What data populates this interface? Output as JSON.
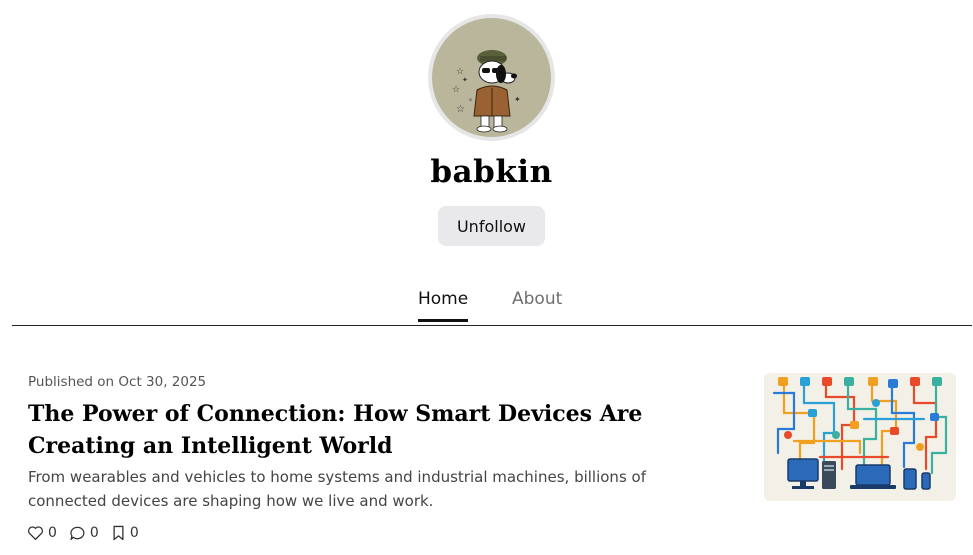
{
  "profile": {
    "username": "babkin",
    "follow_button_label": "Unfollow"
  },
  "tabs": [
    {
      "label": "Home",
      "active": true
    },
    {
      "label": "About",
      "active": false
    }
  ],
  "posts": [
    {
      "published": "Published on Oct 30, 2025",
      "title": "The Power of Connection: How Smart Devices Are Creating an Intelligent World",
      "excerpt": "From wearables and vehicles to home systems and industrial machines, billions of connected devices are shaping how we live and work.",
      "likes": "0",
      "comments": "0",
      "bookmarks": "0"
    }
  ],
  "colors": {
    "accent_text": "#111111",
    "muted_text": "#6f6f6f",
    "button_bg": "#e9e9ec",
    "avatar_bg": "#b9b69c"
  },
  "icons": {
    "like": "heart-icon",
    "comment": "comment-bubble-icon",
    "bookmark": "bookmark-icon"
  }
}
